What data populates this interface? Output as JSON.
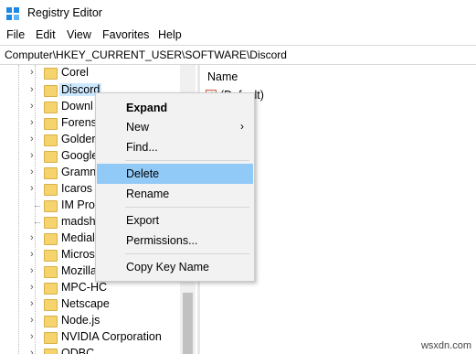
{
  "window": {
    "title": "Registry Editor",
    "accent": "#0078d7"
  },
  "menu": [
    "File",
    "Edit",
    "View",
    "Favorites",
    "Help"
  ],
  "address": "Computer\\HKEY_CURRENT_USER\\SOFTWARE\\Discord",
  "tree": {
    "items": [
      {
        "label": "Corel",
        "expander": true
      },
      {
        "label": "Discord",
        "expander": true,
        "selected": true
      },
      {
        "label": "Downl",
        "expander": true
      },
      {
        "label": "Forens",
        "expander": true
      },
      {
        "label": "Golder",
        "expander": true
      },
      {
        "label": "Google",
        "expander": true
      },
      {
        "label": "Gramn",
        "expander": true
      },
      {
        "label": "Icaros",
        "expander": true
      },
      {
        "label": "IM Pro",
        "expander": false
      },
      {
        "label": "madsh",
        "expander": false
      },
      {
        "label": "Medial",
        "expander": true
      },
      {
        "label": "Micros",
        "expander": true
      },
      {
        "label": "Mozilla",
        "expander": true
      },
      {
        "label": "MPC-HC",
        "expander": true
      },
      {
        "label": "Netscape",
        "expander": true
      },
      {
        "label": "Node.js",
        "expander": true
      },
      {
        "label": "NVIDIA Corporation",
        "expander": true
      },
      {
        "label": "ODBC",
        "expander": true
      }
    ]
  },
  "right_pane": {
    "column_name": "Name",
    "value_name": "(Default)",
    "value_icon": "string-value-icon"
  },
  "context_menu": {
    "items": [
      {
        "label": "Expand",
        "bold": true
      },
      {
        "label": "New",
        "submenu": true
      },
      {
        "label": "Find..."
      },
      {
        "separator": true
      },
      {
        "label": "Delete",
        "highlighted": true
      },
      {
        "label": "Rename"
      },
      {
        "separator": true
      },
      {
        "label": "Export"
      },
      {
        "label": "Permissions..."
      },
      {
        "separator": true
      },
      {
        "label": "Copy Key Name"
      }
    ]
  },
  "watermark": "wsxdn.com"
}
